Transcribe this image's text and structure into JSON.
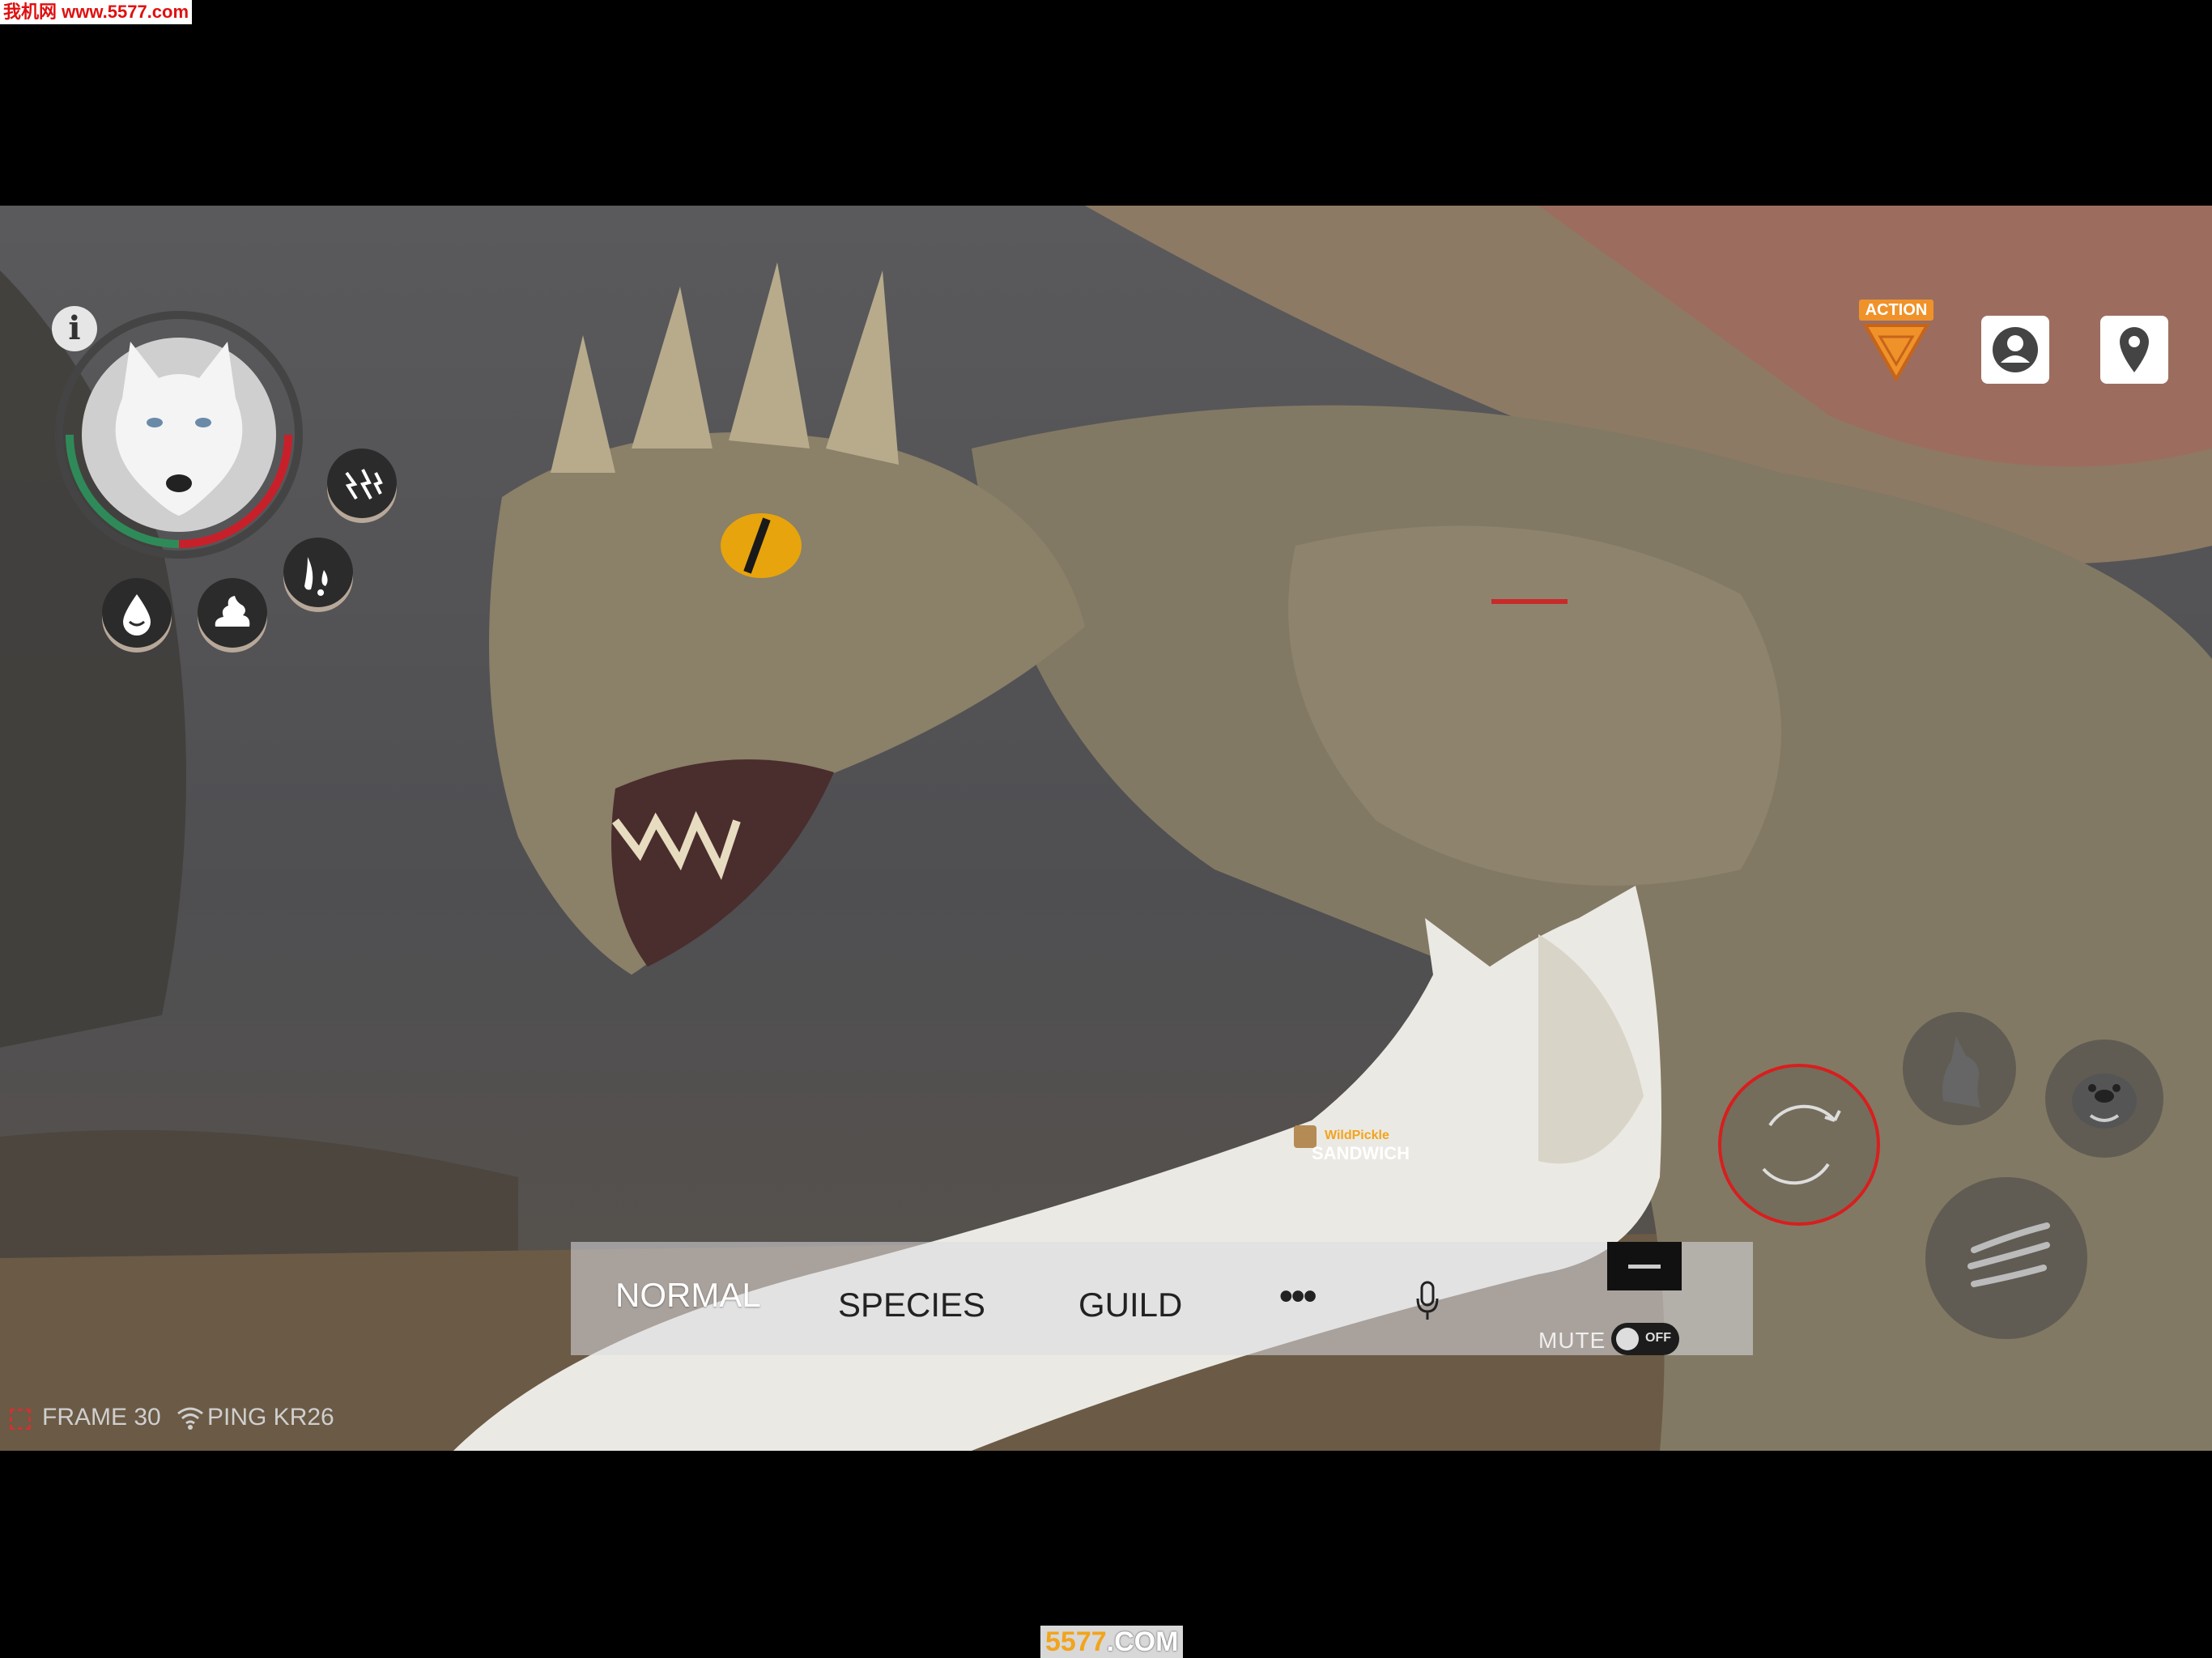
{
  "watermark_top": "我机网 www.5577.com",
  "watermark_bottom": {
    "brand": "5577",
    "suffix": ".COM"
  },
  "hud": {
    "info_label": "i",
    "action_label": "ACTION",
    "health_fraction": 0.45,
    "stamina_fraction": 0.45,
    "colors": {
      "health": "#c8202a",
      "stamina": "#2f8a5a",
      "accent": "#f0922a"
    }
  },
  "status_icons": [
    "thunder-icon",
    "blood-drip-icon",
    "water-drop-icon",
    "poop-icon"
  ],
  "top_right_buttons": [
    "profile-icon",
    "map-pin-icon"
  ],
  "chat": {
    "tabs": [
      "NORMAL",
      "SPECIES",
      "GUILD"
    ],
    "more_label": "•••",
    "mute_label": "MUTE",
    "mute_state": "OFF"
  },
  "player_tag": {
    "guild": "WildPickle",
    "name": "SANDWICH"
  },
  "status_bar": {
    "frame": "FRAME 30",
    "ping": "PING KR26"
  },
  "controls": [
    "rotate-camera-icon",
    "howl-icon",
    "bark-icon",
    "claw-attack-icon"
  ]
}
